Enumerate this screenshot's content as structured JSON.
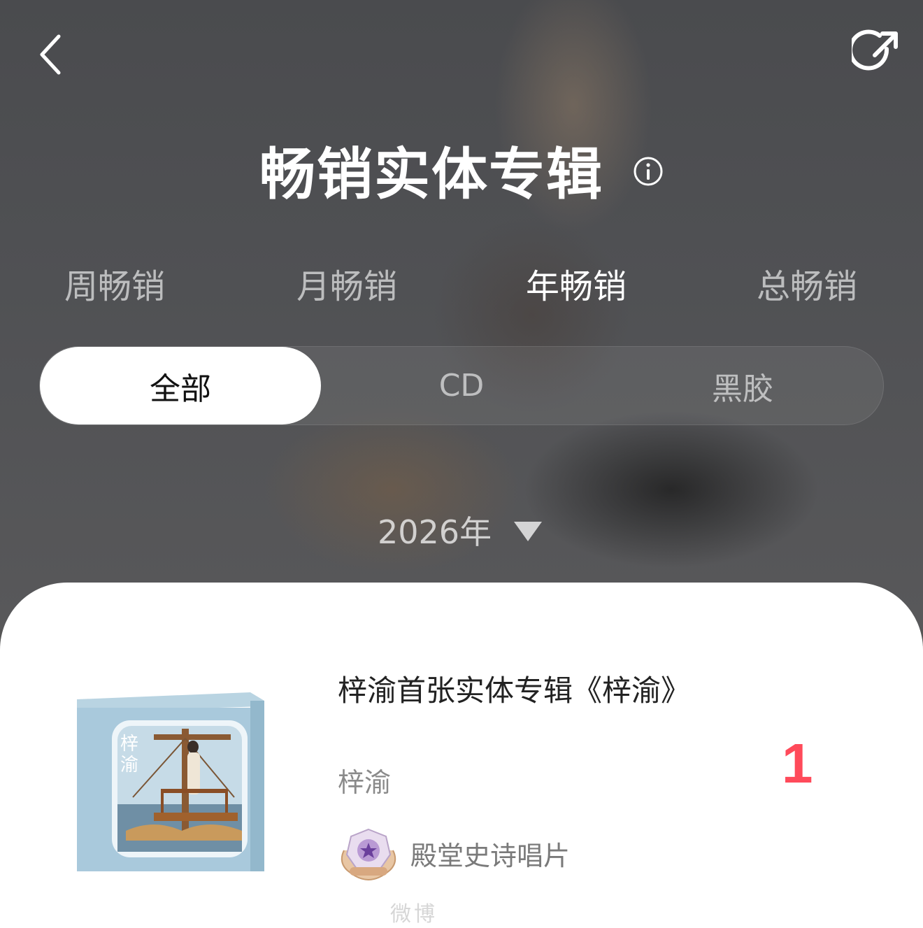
{
  "header": {
    "title": "畅销实体专辑",
    "back_icon": "chevron-left-icon",
    "share_icon": "share-icon",
    "info_icon": "info-icon"
  },
  "period_tabs": [
    {
      "label": "周畅销",
      "active": false
    },
    {
      "label": "月畅销",
      "active": false
    },
    {
      "label": "年畅销",
      "active": true
    },
    {
      "label": "总畅销",
      "active": false
    }
  ],
  "format_tabs": [
    {
      "label": "全部",
      "active": true
    },
    {
      "label": "CD",
      "active": false
    },
    {
      "label": "黑胶",
      "active": false
    }
  ],
  "year_selector": {
    "value": "2026年",
    "icon": "triangle-down-icon"
  },
  "list": [
    {
      "rank": "1",
      "title": "梓渝首张实体专辑《梓渝》",
      "artist": "梓渝",
      "badge": "殿堂史诗唱片",
      "cover_text": "梓渝"
    }
  ],
  "colors": {
    "accent_rank": "#ff4a5a",
    "active_tab_bg": "#ffffff"
  },
  "watermark": "微博"
}
